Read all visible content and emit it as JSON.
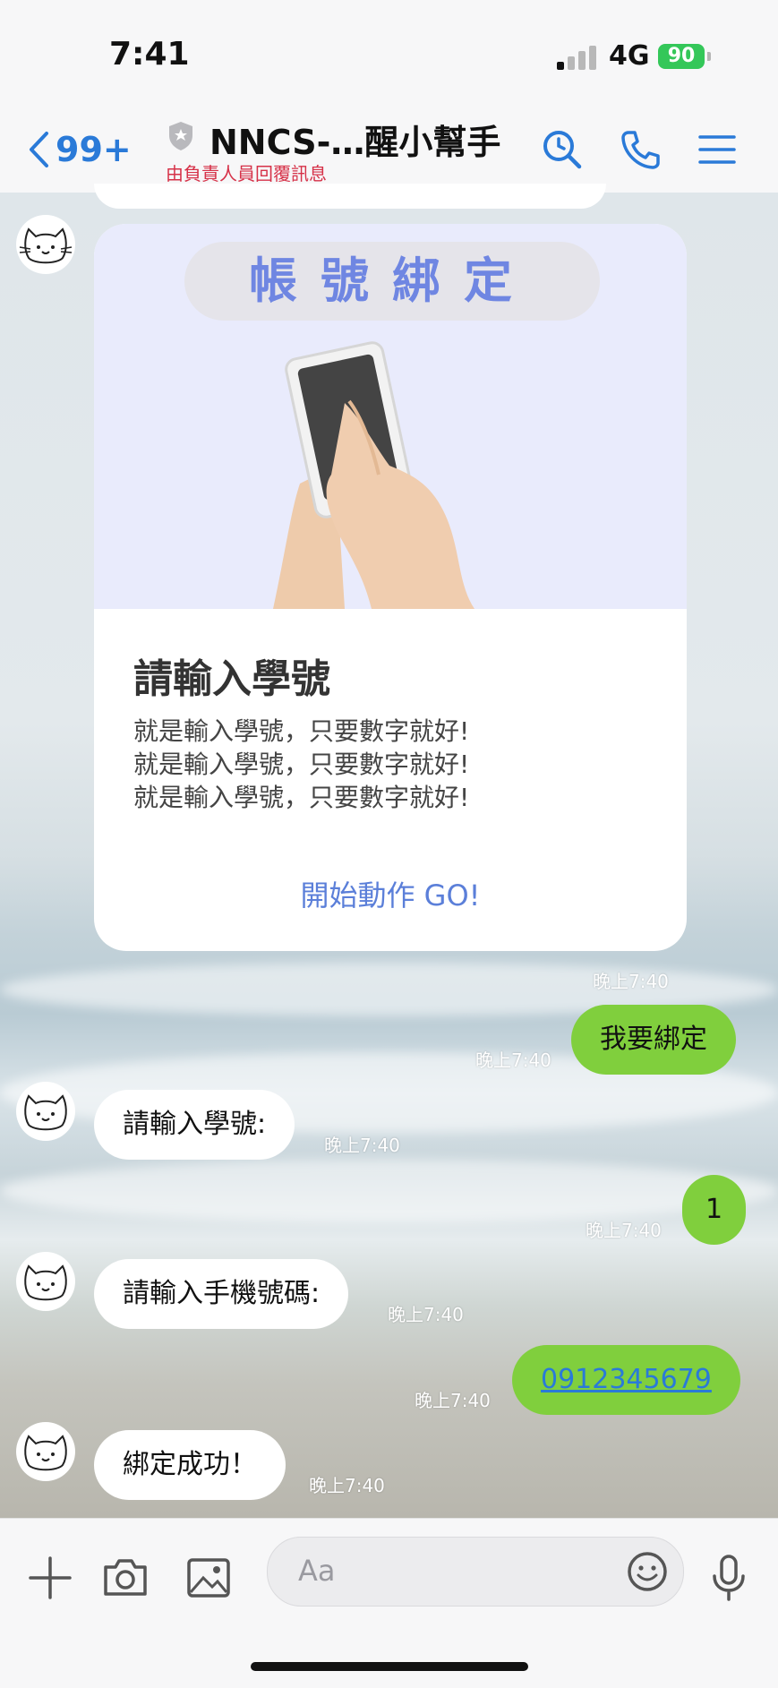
{
  "status_bar": {
    "time": "7:41",
    "network": "4G",
    "battery": "90"
  },
  "header": {
    "back_count": "99+",
    "title": "NNCS-…醒小幫手",
    "subtitle": "由負責人員回覆訊息",
    "icons": [
      "search-icon",
      "phone-icon",
      "menu-icon"
    ],
    "colors": {
      "accent": "#2a7ad8",
      "subtitle": "#d63148"
    }
  },
  "card": {
    "pill_text": "帳號綁定",
    "title": "請輸入學號",
    "body_lines": [
      "就是輸入學號，只要數字就好!",
      "就是輸入學號，只要數字就好!",
      "就是輸入學號，只要數字就好!"
    ],
    "action": "開始動作 GO!",
    "timestamp": "晚上7:40"
  },
  "messages": [
    {
      "direction": "out",
      "text": "我要綁定",
      "time": "晚上7:40"
    },
    {
      "direction": "in",
      "text": "請輸入學號:",
      "time": "晚上7:40"
    },
    {
      "direction": "out",
      "text": "1",
      "time": "晚上7:40"
    },
    {
      "direction": "in",
      "text": "請輸入手機號碼:",
      "time": "晚上7:40"
    },
    {
      "direction": "out",
      "text": "0912345679",
      "time": "晚上7:40"
    },
    {
      "direction": "in",
      "text": "綁定成功！",
      "time": "晚上7:40"
    }
  ],
  "input_bar": {
    "placeholder": "Aa",
    "icons": [
      "plus-icon",
      "camera-icon",
      "image-icon",
      "emoji-icon",
      "microphone-icon"
    ]
  },
  "colors": {
    "outgoing_bubble": "#80cf3d",
    "link": "#2a7ad8"
  }
}
